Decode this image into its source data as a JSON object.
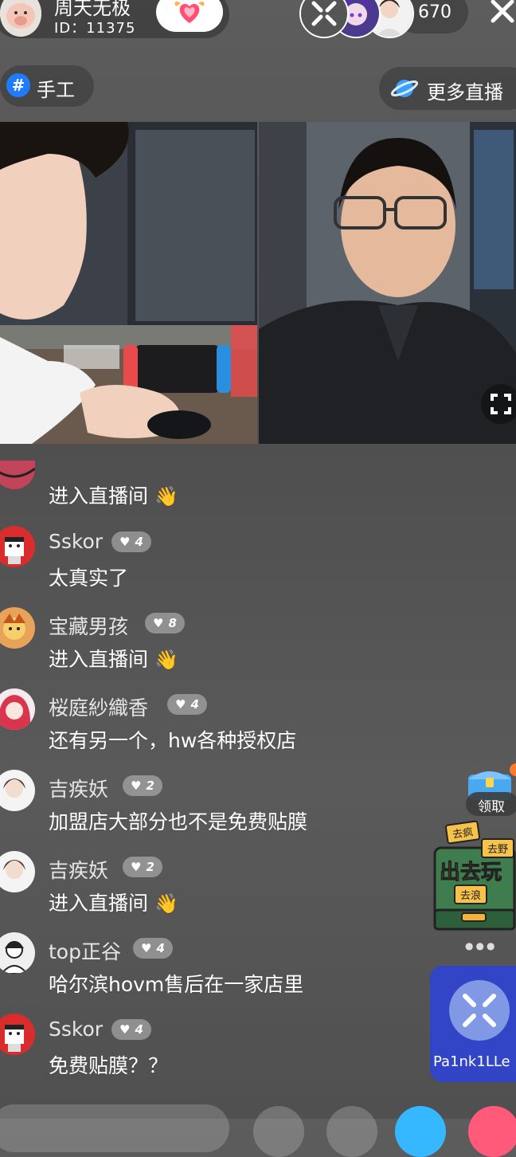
{
  "host": {
    "name": "周天无极",
    "id": "ID：11375"
  },
  "viewers": {
    "count": "670"
  },
  "tag": {
    "icon": "hash-icon",
    "label": "手工"
  },
  "more_live": {
    "icon": "planet-icon",
    "label": "更多直播"
  },
  "chat": [
    {
      "name": "",
      "level": "",
      "message": "进入直播间",
      "wave": true
    },
    {
      "name": "Sskor",
      "level": "4",
      "message": "太真实了",
      "wave": false
    },
    {
      "name": "宝藏男孩",
      "level": "8",
      "message": "进入直播间",
      "wave": true
    },
    {
      "name": "桜庭紗織香",
      "level": "4",
      "message": "还有另一个，hw各种授权店",
      "wave": false
    },
    {
      "name": "吉疾妖",
      "level": "2",
      "message": "加盟店大部分也不是免费贴膜",
      "wave": false
    },
    {
      "name": "吉疾妖",
      "level": "2",
      "message": "进入直播间",
      "wave": true
    },
    {
      "name": "top正谷",
      "level": "4",
      "message": "哈尔滨hovm售后在一家店里",
      "wave": false
    },
    {
      "name": "Sskor",
      "level": "4",
      "message": "免费贴膜？？",
      "wave": false
    }
  ],
  "widgets": {
    "chest_label": "领取",
    "promo": {
      "title": "出去玩",
      "tags": [
        "去疯",
        "去野",
        "去浪"
      ]
    },
    "pk_label": "Pa1nk1LLe"
  },
  "colors": {
    "accent_blue": "#1f7bff",
    "pk_card": "#3245c6",
    "gift_pink": "#ff5a7a"
  }
}
